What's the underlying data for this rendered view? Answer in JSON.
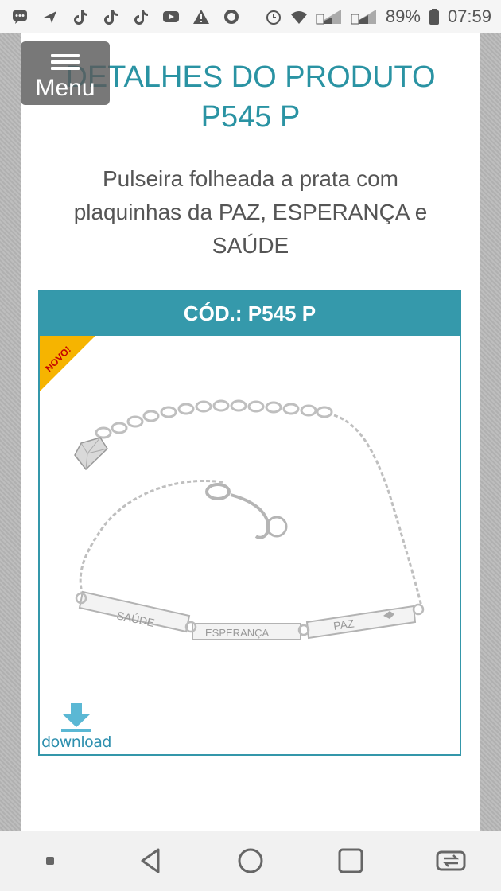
{
  "status_bar": {
    "battery": "89%",
    "time": "07:59",
    "left_icons": [
      "chat-icon",
      "plane-icon",
      "tiktok-icon",
      "tiktok-icon",
      "tiktok-icon",
      "youtube-icon",
      "warning-icon",
      "record-icon"
    ],
    "right_icons": [
      "alarm-icon",
      "wifi-icon",
      "signal-1-icon",
      "signal-2-icon",
      "battery-icon"
    ]
  },
  "menu": {
    "label": "Menu"
  },
  "page": {
    "title_line1": "DETALHES DO PRODUTO",
    "title_line2": "P545 P",
    "description": "Pulseira folheada a prata com plaquinhas da PAZ, ESPERANÇA e SAÚDE"
  },
  "product_card": {
    "code": "CÓD.: P545 P",
    "badge": "NOVO!",
    "plate_labels": [
      "SAÚDE",
      "ESPERANÇA",
      "PAZ"
    ],
    "download_label": "download"
  },
  "colors": {
    "accent": "#3599ab",
    "title": "#2a93a3",
    "badge": "#f5b400"
  },
  "nav_bar": {
    "buttons": [
      "recents-dot-icon",
      "back-icon",
      "home-icon",
      "overview-icon",
      "rotate-icon"
    ]
  }
}
